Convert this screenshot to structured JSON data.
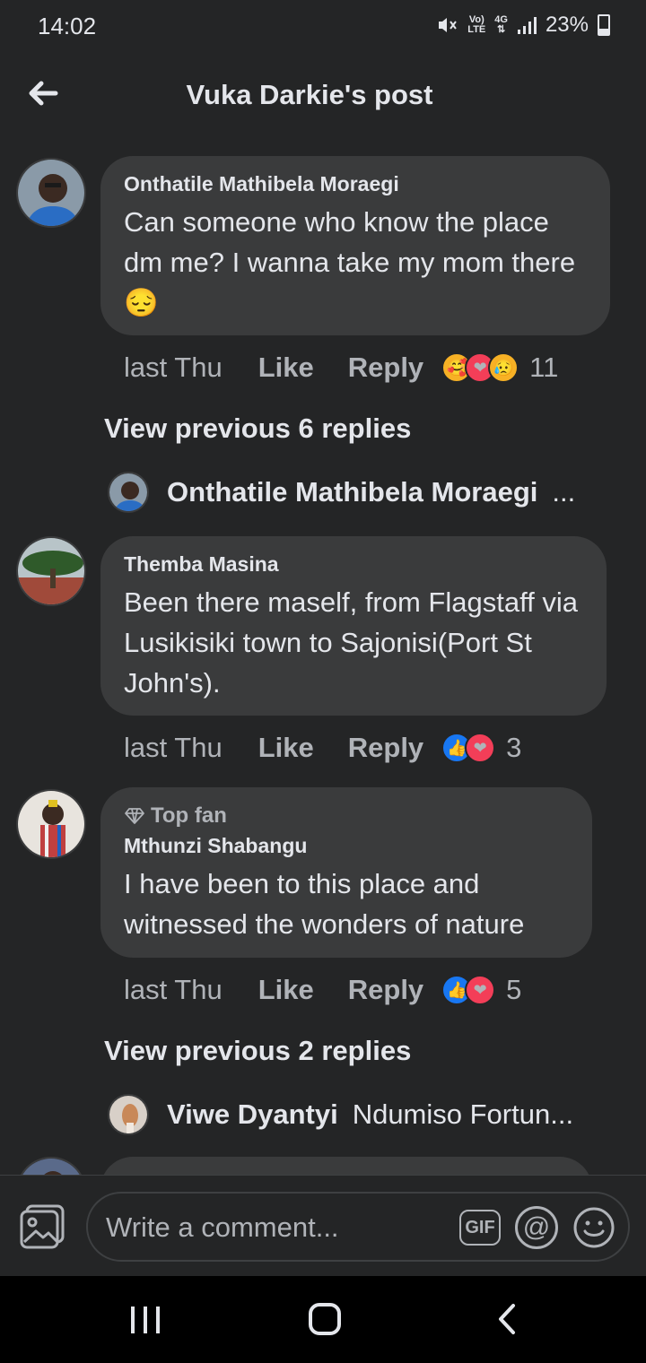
{
  "status_bar": {
    "time": "14:02",
    "network_top": "Vo)",
    "network_bottom": "LTE",
    "net_type": "4G",
    "battery": "23%"
  },
  "header": {
    "title": "Vuka Darkie's post",
    "back_icon": "arrow-left-icon"
  },
  "comments": [
    {
      "author": "Onthatile Mathibela Moraegi",
      "text": "Can someone who know the place dm me? I wanna take my mom there",
      "emoji": "😔",
      "time": "last Thu",
      "like_label": "Like",
      "reply_label": "Reply",
      "reactions": [
        "🥰",
        "❤",
        "😥"
      ],
      "reaction_count": "11",
      "view_previous": "View previous 6 replies",
      "reply_preview_name": "Onthatile Mathibela Moraegi",
      "reply_preview_text": "..."
    },
    {
      "author": "Themba Masina",
      "text": "Been there maself, from Flagstaff via Lusikisiki town to Sajonisi(Port St John's).",
      "time": "last Thu",
      "like_label": "Like",
      "reply_label": "Reply",
      "reactions": [
        "👍",
        "❤"
      ],
      "reaction_count": "3"
    },
    {
      "badge": "Top fan",
      "author": "Mthunzi Shabangu",
      "text": "I have been to this place and witnessed the wonders of nature",
      "time": "last Thu",
      "like_label": "Like",
      "reply_label": "Reply",
      "reactions": [
        "👍",
        "❤"
      ],
      "reaction_count": "5",
      "view_previous": "View previous 2 replies",
      "reply_preview_name": "Viwe Dyantyi",
      "reply_preview_text": "Ndumiso Fortun..."
    }
  ],
  "composer": {
    "placeholder": "Write a comment...",
    "gif_label": "GIF",
    "at_label": "@"
  },
  "colors": {
    "background": "#242526",
    "bubble": "#3a3b3c",
    "text": "#e4e6eb",
    "muted": "#b0b3b8",
    "like_blue": "#1877f2",
    "love_red": "#f33e58"
  }
}
